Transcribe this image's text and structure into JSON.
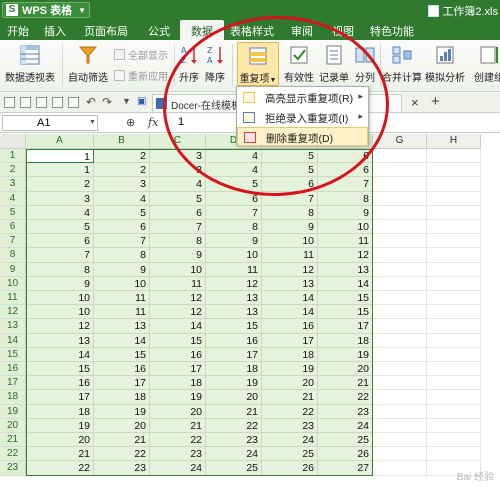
{
  "app": {
    "name": "WPS 表格",
    "logo": "S",
    "document_title": "工作簿2.xls"
  },
  "menu_tabs": [
    "开始",
    "插入",
    "页面布局",
    "公式",
    "数据",
    "表格样式",
    "审阅",
    "视图",
    "特色功能"
  ],
  "active_tab": "数据",
  "ribbon": {
    "pivot_table": "数据透视表",
    "auto_filter": "自动筛选",
    "show_all": "全部显示",
    "reapply": "重新应用",
    "sort_asc": "升序",
    "sort_desc": "降序",
    "duplicates": "重复项",
    "validity": "有效性",
    "record_list": "记录单",
    "split": "分列",
    "consolidate": "合并计算",
    "simulation": "模拟分析",
    "create_group": "创建组"
  },
  "doc_tab": {
    "label": "Docer-在线模板",
    "close": "×",
    "add": "+"
  },
  "formula_bar": {
    "name_box": "A1",
    "fx": "fx",
    "zoom_glyph": "⊕",
    "value": "1"
  },
  "dropdown": {
    "items": [
      {
        "label": "高亮显示重复项(R)",
        "has_submenu": true
      },
      {
        "label": "拒绝录入重复项(I)",
        "has_submenu": true
      },
      {
        "label": "删除重复项(D)",
        "has_submenu": false
      }
    ],
    "hovered_index": 2
  },
  "grid": {
    "columns": [
      "A",
      "B",
      "C",
      "D",
      "E",
      "F",
      "G",
      "H"
    ],
    "selected_columns": [
      "A",
      "B",
      "C",
      "D",
      "E",
      "F"
    ],
    "rows": [
      [
        1,
        2,
        3,
        4,
        5,
        6
      ],
      [
        1,
        2,
        3,
        4,
        5,
        6
      ],
      [
        2,
        3,
        4,
        5,
        6,
        7
      ],
      [
        3,
        4,
        5,
        6,
        7,
        8
      ],
      [
        4,
        5,
        6,
        7,
        8,
        9
      ],
      [
        5,
        6,
        7,
        8,
        9,
        10
      ],
      [
        6,
        7,
        8,
        9,
        10,
        11
      ],
      [
        7,
        8,
        9,
        10,
        11,
        12
      ],
      [
        8,
        9,
        10,
        11,
        12,
        13
      ],
      [
        9,
        10,
        11,
        12,
        13,
        14
      ],
      [
        10,
        11,
        12,
        13,
        14,
        15
      ],
      [
        10,
        11,
        12,
        13,
        14,
        15
      ],
      [
        12,
        13,
        14,
        15,
        16,
        17
      ],
      [
        13,
        14,
        15,
        16,
        17,
        18
      ],
      [
        14,
        15,
        16,
        17,
        18,
        19
      ],
      [
        15,
        16,
        17,
        18,
        19,
        20
      ],
      [
        16,
        17,
        18,
        19,
        20,
        21
      ],
      [
        17,
        18,
        19,
        20,
        21,
        22
      ],
      [
        18,
        19,
        20,
        21,
        22,
        23
      ],
      [
        19,
        20,
        21,
        22,
        23,
        24
      ],
      [
        20,
        21,
        22,
        23,
        24,
        25
      ],
      [
        21,
        22,
        23,
        24,
        25,
        26
      ],
      [
        22,
        23,
        24,
        25,
        26,
        27
      ]
    ]
  },
  "colors": {
    "brand_green": "#2f7a2f",
    "selection": "#e5f3dc",
    "annotation_red": "#d6141b",
    "hover_item": "#fff2c8"
  },
  "watermark": "Bai 经验"
}
